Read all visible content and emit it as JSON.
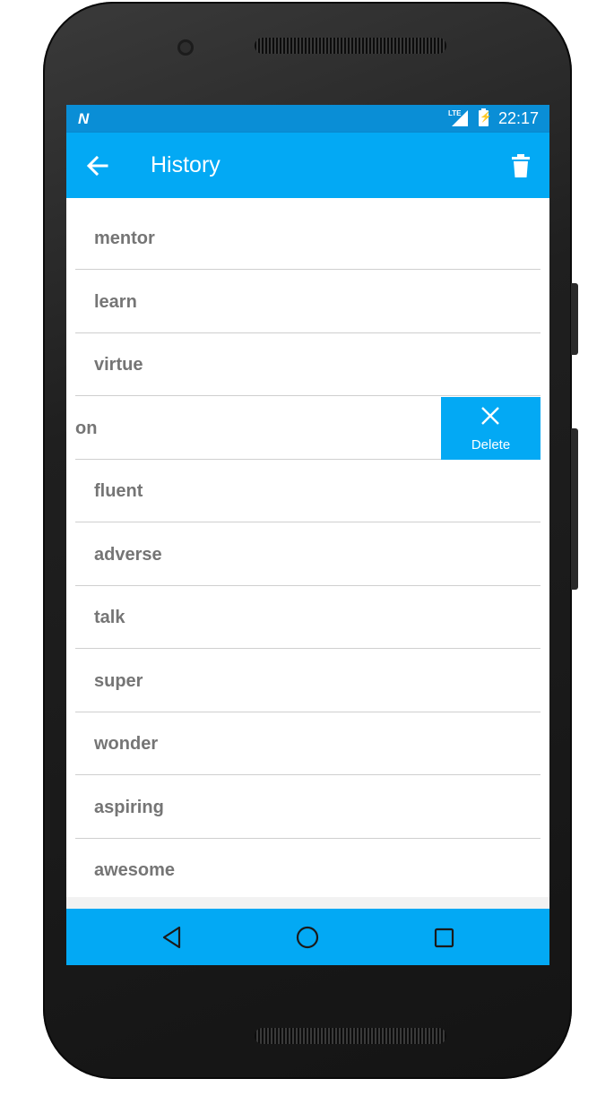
{
  "status_bar": {
    "notification_icon": "N",
    "network_label": "LTE",
    "time": "22:17"
  },
  "toolbar": {
    "title": "History",
    "back_icon": "arrow-left-icon",
    "action_icon": "trash-icon"
  },
  "history": {
    "items": [
      {
        "word": "mentor"
      },
      {
        "word": "learn"
      },
      {
        "word": "virtue"
      },
      {
        "word": "on",
        "swiped": true
      },
      {
        "word": "fluent"
      },
      {
        "word": "adverse"
      },
      {
        "word": "talk"
      },
      {
        "word": "super"
      },
      {
        "word": "wonder"
      },
      {
        "word": "aspiring"
      },
      {
        "word": "awesome"
      }
    ],
    "delete_label": "Delete"
  },
  "nav_bar": {
    "icons": [
      "back-triangle-icon",
      "home-circle-icon",
      "recents-square-icon"
    ]
  },
  "colors": {
    "primary": "#03a9f4",
    "status_bar": "#0a8ed6",
    "text_secondary": "#757575"
  }
}
